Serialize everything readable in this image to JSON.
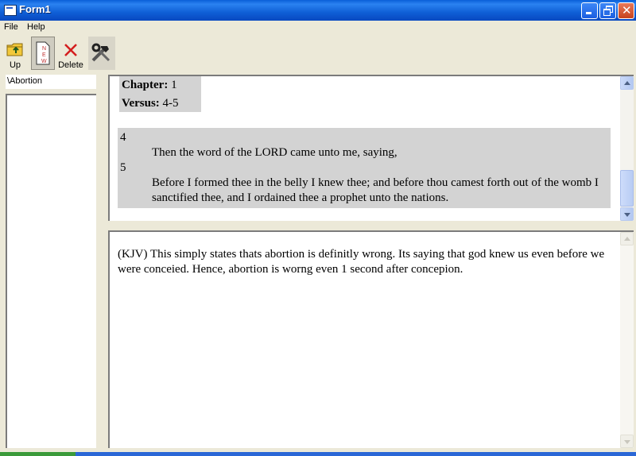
{
  "window": {
    "title": "Form1"
  },
  "menu": {
    "items": [
      {
        "label": "File"
      },
      {
        "label": "Help"
      }
    ]
  },
  "toolbar": {
    "up_label": "Up",
    "new_label": "N\nE\nW",
    "delete_label": "Delete"
  },
  "left_pane": {
    "path": "\\Abortion"
  },
  "verse": {
    "chapter_label": "Chapter:",
    "chapter_value": "1",
    "versus_label": "Versus:",
    "versus_value": "4-5",
    "items": [
      {
        "number": "4",
        "text": "Then the word of the LORD came unto me, saying,"
      },
      {
        "number": "5",
        "line1": "Before I formed thee in the belly I knew thee; and before thou camest forth out of the womb I",
        "line2": "sanctified thee, and I ordained thee a prophet unto the nations."
      }
    ]
  },
  "notes": {
    "line1": "(KJV) This simply states thats abortion is definitly wrong. Its saying that god knew us even before we",
    "line2": "were conceied. Hence, abortion is worng even 1 second after concepion."
  },
  "colors": {
    "titlebar": "#0a5fd8",
    "face": "#ece9d8",
    "highlight": "#d3d3d3"
  }
}
